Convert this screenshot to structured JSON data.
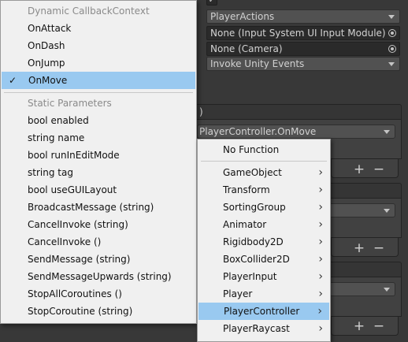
{
  "inspector": {
    "checkbox_mark": "✓",
    "actions_asset": "PlayerActions",
    "ui_input_module": "None (Input System UI Input Module)",
    "camera": "None (Camera)",
    "behavior": "Invoke Unity Events",
    "event_header_fragment": ")",
    "function_value": "PlayerController.OnMove",
    "plus": "+",
    "minus": "−"
  },
  "left_menu": {
    "dynamic_header": "Dynamic CallbackContext",
    "dynamic_items": [
      {
        "label": "OnAttack",
        "selected": false
      },
      {
        "label": "OnDash",
        "selected": false
      },
      {
        "label": "OnJump",
        "selected": false
      },
      {
        "label": "OnMove",
        "selected": true
      }
    ],
    "check_mark": "✓",
    "static_header": "Static Parameters",
    "static_items": [
      "bool enabled",
      "string name",
      "bool runInEditMode",
      "string tag",
      "bool useGUILayout",
      "BroadcastMessage (string)",
      "CancelInvoke (string)",
      "CancelInvoke ()",
      "SendMessage (string)",
      "SendMessageUpwards (string)",
      "StopAllCoroutines ()",
      "StopCoroutine (string)"
    ]
  },
  "right_menu": {
    "no_function": "No Function",
    "arrow": "›",
    "items": [
      {
        "label": "GameObject",
        "selected": false
      },
      {
        "label": "Transform",
        "selected": false
      },
      {
        "label": "SortingGroup",
        "selected": false
      },
      {
        "label": "Animator",
        "selected": false
      },
      {
        "label": "Rigidbody2D",
        "selected": false
      },
      {
        "label": "BoxCollider2D",
        "selected": false
      },
      {
        "label": "PlayerInput",
        "selected": false
      },
      {
        "label": "Player",
        "selected": false
      },
      {
        "label": "PlayerController",
        "selected": true
      },
      {
        "label": "PlayerRaycast",
        "selected": false
      }
    ]
  }
}
